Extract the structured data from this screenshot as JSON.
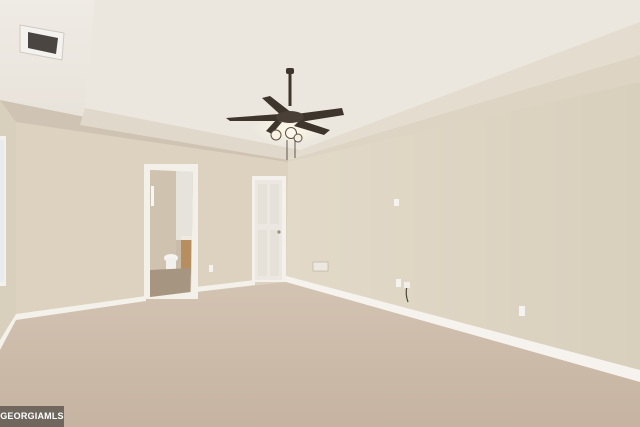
{
  "photo": {
    "subject": "empty-bedroom-interior"
  },
  "watermark": {
    "text": "GEORGIAMLS"
  },
  "colors": {
    "wall": "#ddd3c1",
    "wall_shadow": "#d2c7b4",
    "ceiling": "#ece7e0",
    "carpet": "#cdbba9",
    "trim": "#f6f3ee",
    "fan": "#3e352d"
  }
}
